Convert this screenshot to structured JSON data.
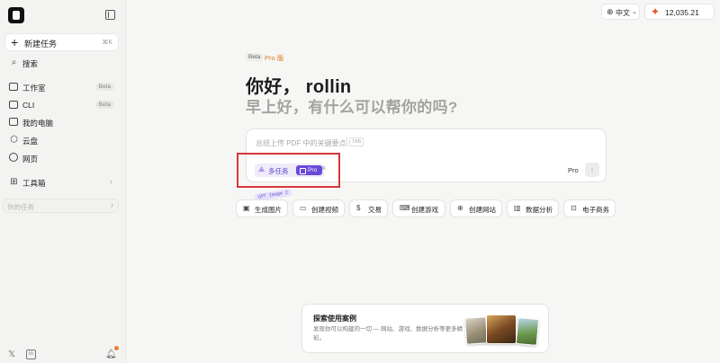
{
  "sidebar": {
    "new_task": {
      "label": "新建任务",
      "shortcut": "⌘K",
      "icon": "plus-icon"
    },
    "items": [
      {
        "label": "搜索",
        "icon": "search-icon",
        "badge": ""
      },
      {
        "label": "工作室",
        "icon": "studio-icon",
        "badge": "Beta"
      },
      {
        "label": "CLI",
        "icon": "terminal-icon",
        "badge": "Beta"
      },
      {
        "label": "我的电脑",
        "icon": "monitor-icon",
        "badge": ""
      },
      {
        "label": "云盘",
        "icon": "cloud-box-icon",
        "badge": ""
      },
      {
        "label": "网页",
        "icon": "globe-icon",
        "badge": ""
      },
      {
        "label": "工具箱",
        "icon": "grid-icon",
        "badge": ""
      }
    ],
    "task_search_placeholder": "你的任务"
  },
  "topbar": {
    "language": "中文",
    "credits": "12,035.21",
    "accent": "#e0552b"
  },
  "hero": {
    "beta": "Beta",
    "pro_version": "Pro 版",
    "greeting": "你好， rollin",
    "subtitle": "早上好，有什么可以帮你的吗?"
  },
  "composer": {
    "placeholder": "总结上传 PDF 中的关键要点",
    "tab_hint": "TAB",
    "mode_label": "多任务",
    "mode_badge": "Pro",
    "model_label": "Pro",
    "mode_color": "#6b49d8"
  },
  "chips": {
    "image_tag": "GPT Image 2",
    "items": [
      {
        "label": "生成图片",
        "icon": "image-icon"
      },
      {
        "label": "创建视频",
        "icon": "video-icon"
      },
      {
        "label": "交易",
        "icon": "dollar-icon"
      },
      {
        "label": "创建游戏",
        "icon": "gamepad-icon"
      },
      {
        "label": "创建网站",
        "icon": "globe-icon"
      },
      {
        "label": "数据分析",
        "icon": "bar-chart-icon"
      },
      {
        "label": "电子商务",
        "icon": "shopping-bag-icon"
      }
    ]
  },
  "explore": {
    "title": "探索使用案例",
    "description": "发现你可以构建的一切 — 网站、游戏、数据分析等更多精彩。"
  },
  "highlight_color": "#d6393a"
}
